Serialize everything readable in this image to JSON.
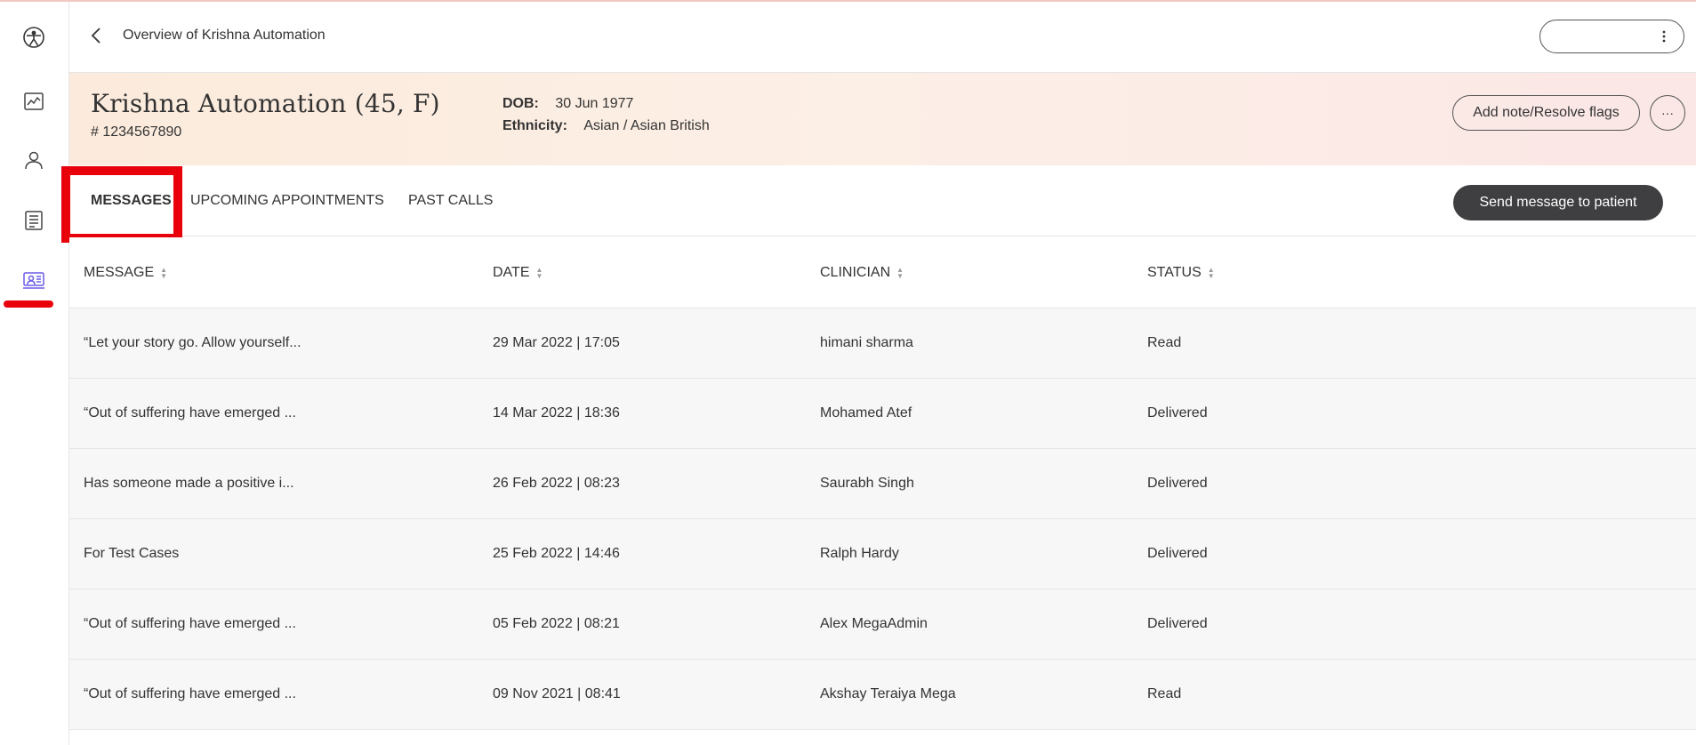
{
  "header": {
    "page_title": "Overview of Krishna Automation"
  },
  "sidebar": {
    "items": [
      {
        "icon": "logo-icon"
      },
      {
        "icon": "chart-icon"
      },
      {
        "icon": "person-icon"
      },
      {
        "icon": "document-list-icon"
      },
      {
        "icon": "patient-monitor-icon",
        "active": true
      }
    ],
    "accent_color": "#6b5ce7",
    "active_marker_color": "#e8000b"
  },
  "patient": {
    "name": "Krishna Automation (45, F)",
    "id": "# 1234567890",
    "dob_label": "DOB:",
    "dob_value": "30 Jun 1977",
    "ethnicity_label": "Ethnicity:",
    "ethnicity_value": "Asian / Asian British",
    "add_note_label": "Add note/Resolve flags",
    "more_label": "···"
  },
  "tabs": [
    {
      "label": "MESSAGES",
      "active": true
    },
    {
      "label": "UPCOMING APPOINTMENTS",
      "active": false
    },
    {
      "label": "PAST CALLS",
      "active": false
    }
  ],
  "send_message_label": "Send message to patient",
  "table": {
    "columns": [
      "MESSAGE",
      "DATE",
      "CLINICIAN",
      "STATUS"
    ],
    "rows": [
      {
        "message": "“Let your story go. Allow yourself...",
        "date": "29 Mar 2022 | 17:05",
        "clinician": "himani sharma",
        "status": "Read"
      },
      {
        "message": "“Out of suffering have emerged ...",
        "date": "14 Mar 2022 | 18:36",
        "clinician": "Mohamed Atef",
        "status": "Delivered"
      },
      {
        "message": "Has someone made a positive i...",
        "date": "26 Feb 2022 | 08:23",
        "clinician": "Saurabh Singh",
        "status": "Delivered"
      },
      {
        "message": "For Test Cases",
        "date": "25 Feb 2022 | 14:46",
        "clinician": "Ralph Hardy",
        "status": "Delivered"
      },
      {
        "message": "“Out of suffering have emerged ...",
        "date": "05 Feb 2022 | 08:21",
        "clinician": "Alex MegaAdmin",
        "status": "Delivered"
      },
      {
        "message": "“Out of suffering have emerged ...",
        "date": "09 Nov 2021 | 08:41",
        "clinician": "Akshay Teraiya Mega",
        "status": "Read"
      }
    ]
  },
  "colors": {
    "highlight": "#e8000b",
    "primary_button": "#3f3f41",
    "banner_start": "#fcebdc",
    "banner_end": "#fbe7e6"
  }
}
